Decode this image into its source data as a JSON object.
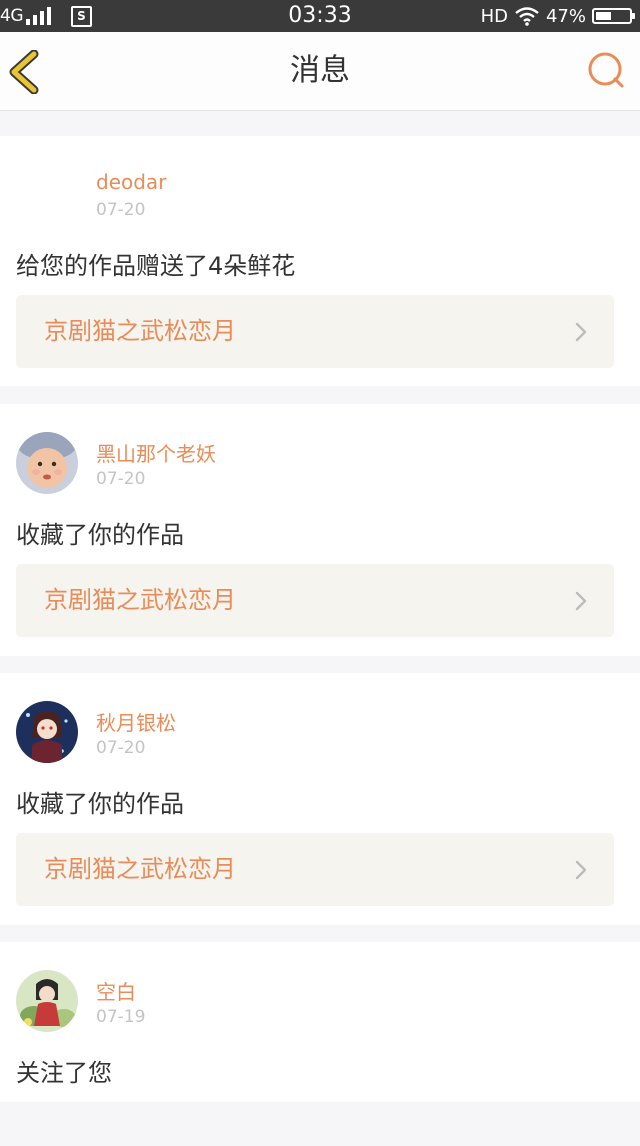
{
  "status_bar": {
    "network": "4G",
    "time": "03:33",
    "hd": "HD",
    "battery": "47%",
    "battery_level": 0.47
  },
  "header": {
    "title": "消息",
    "back_icon": "chevron-left-icon",
    "search_icon": "search-icon"
  },
  "messages": [
    {
      "username": "deodar",
      "date": "07-20",
      "action": "给您的作品赠送了4朵鲜花",
      "work_title": "京剧猫之武松恋月"
    },
    {
      "username": "黑山那个老妖",
      "date": "07-20",
      "action": "收藏了你的作品",
      "work_title": "京剧猫之武松恋月"
    },
    {
      "username": "秋月银松",
      "date": "07-20",
      "action": "收藏了你的作品",
      "work_title": "京剧猫之武松恋月"
    },
    {
      "username": "空白",
      "date": "07-19",
      "action": "关注了您"
    }
  ],
  "colors": {
    "accent": "#e98c58",
    "back_icon": "#e8c531",
    "status_bar": "#3a3a3a",
    "work_box": "#f5f4ef"
  }
}
